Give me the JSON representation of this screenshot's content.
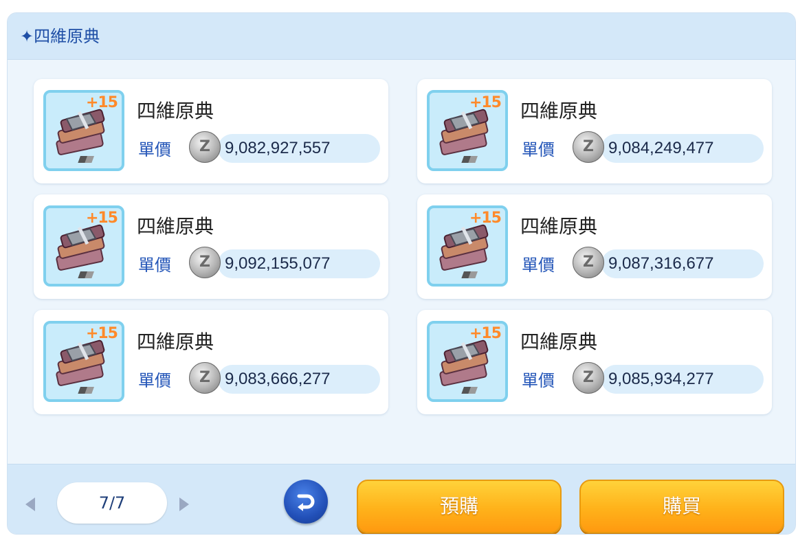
{
  "header": {
    "title": "✦四維原典"
  },
  "items": [
    {
      "name": "四維原典",
      "refine": "+15",
      "unit_label": "單價",
      "currency_symbol": "Z",
      "price": "9,082,927,557"
    },
    {
      "name": "四維原典",
      "refine": "+15",
      "unit_label": "單價",
      "currency_symbol": "Z",
      "price": "9,084,249,477"
    },
    {
      "name": "四維原典",
      "refine": "+15",
      "unit_label": "單價",
      "currency_symbol": "Z",
      "price": "9,092,155,077"
    },
    {
      "name": "四維原典",
      "refine": "+15",
      "unit_label": "單價",
      "currency_symbol": "Z",
      "price": "9,087,316,677"
    },
    {
      "name": "四維原典",
      "refine": "+15",
      "unit_label": "單價",
      "currency_symbol": "Z",
      "price": "9,083,666,277"
    },
    {
      "name": "四維原典",
      "refine": "+15",
      "unit_label": "單價",
      "currency_symbol": "Z",
      "price": "9,085,934,277"
    }
  ],
  "pagination": {
    "page": "7/7"
  },
  "buttons": {
    "preorder": "預購",
    "buy": "購買"
  },
  "icons": {
    "header": "sparkle-icon",
    "item": "book-stack-icon",
    "currency": "zeny-coin-icon",
    "back": "return-icon",
    "prev": "triangle-left-icon",
    "next": "triangle-right-icon"
  },
  "colors": {
    "title": "#1f4fa6",
    "refine": "#ff8a2a",
    "unit_label": "#2456b8",
    "button": "#ffb21a"
  }
}
